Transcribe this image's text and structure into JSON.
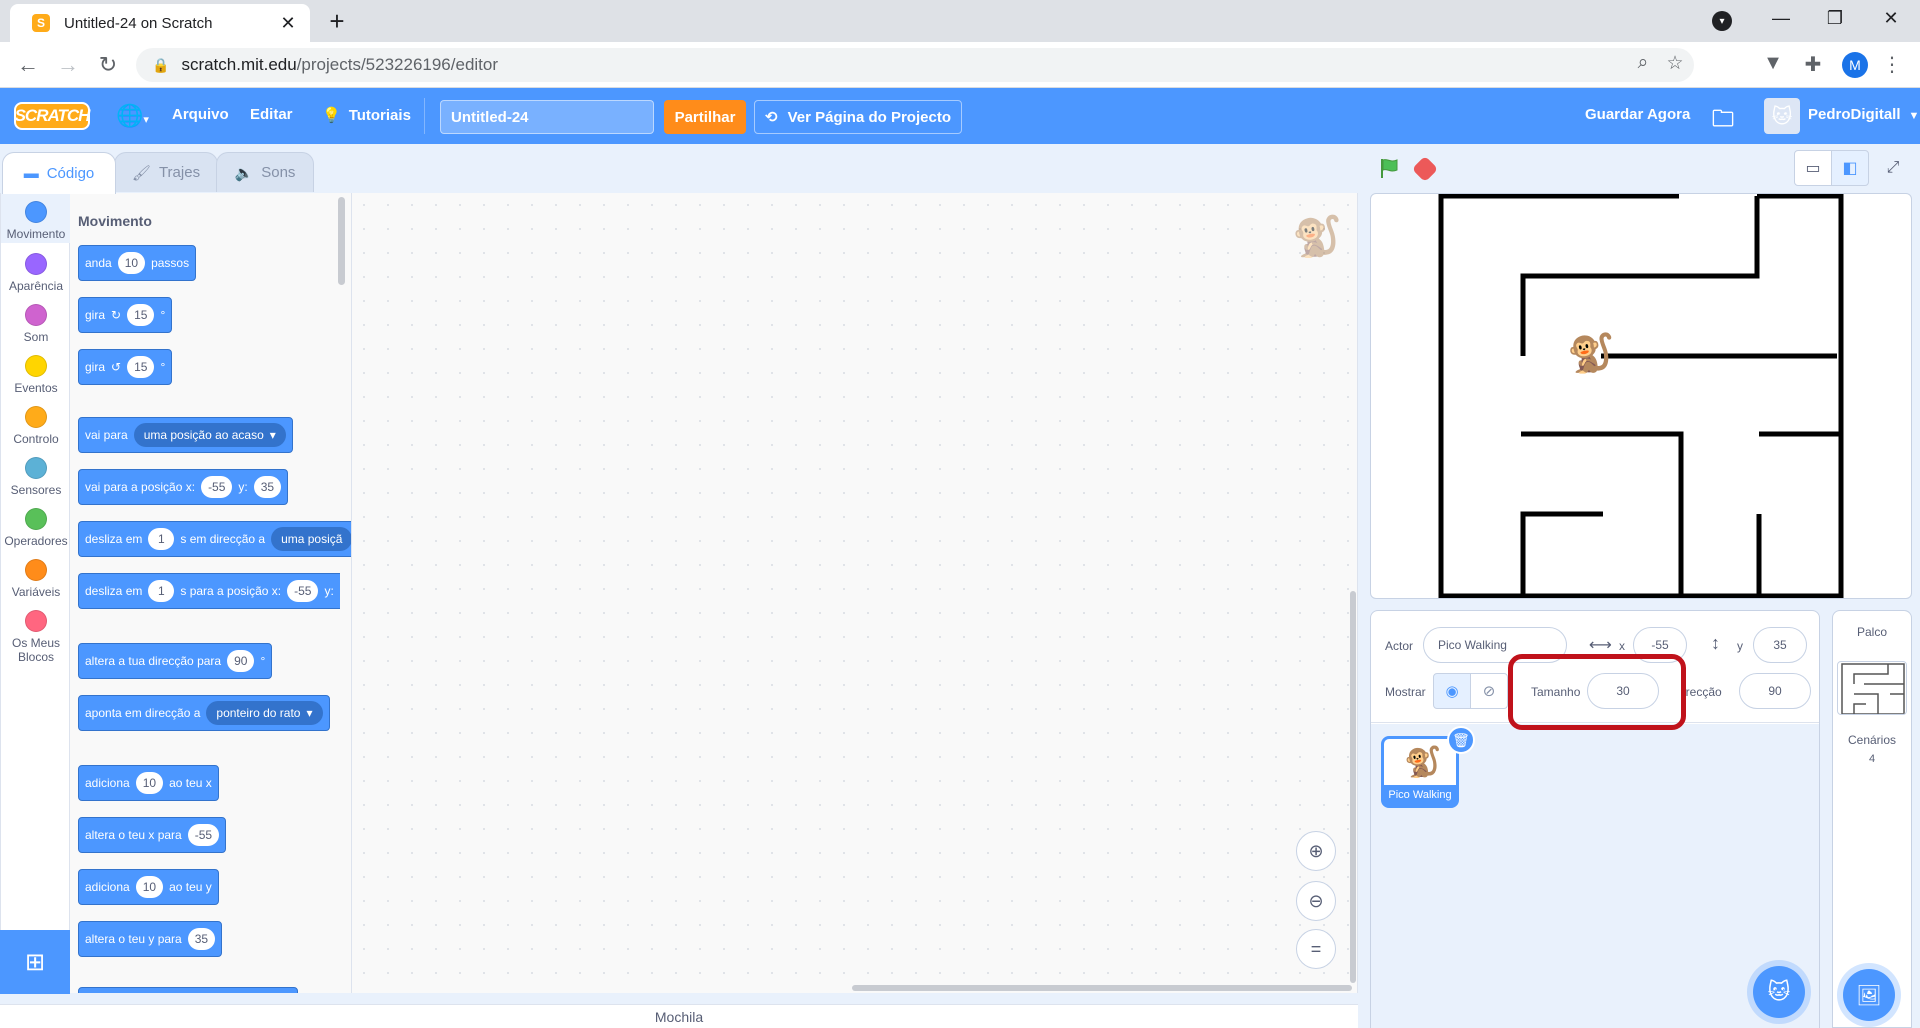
{
  "browser": {
    "tab_title": "Untitled-24 on Scratch",
    "url_host": "scratch.mit.edu",
    "url_path": "/projects/523226196/editor",
    "profile_initial": "M"
  },
  "menubar": {
    "logo": "SCRATCH",
    "file": "Arquivo",
    "edit": "Editar",
    "tutorials": "Tutoriais",
    "project_title": "Untitled-24",
    "share": "Partilhar",
    "see_project": "Ver Página do Projecto",
    "save_now": "Guardar Agora",
    "username": "PedroDigitall"
  },
  "editor_tabs": {
    "code": "Código",
    "costumes": "Trajes",
    "sounds": "Sons"
  },
  "categories": [
    {
      "label": "Movimento",
      "color": "#4c97ff"
    },
    {
      "label": "Aparência",
      "color": "#9966ff"
    },
    {
      "label": "Som",
      "color": "#cf63cf"
    },
    {
      "label": "Eventos",
      "color": "#ffd500"
    },
    {
      "label": "Controlo",
      "color": "#ffab19"
    },
    {
      "label": "Sensores",
      "color": "#5cb1d6"
    },
    {
      "label": "Operadores",
      "color": "#59c059"
    },
    {
      "label": "Variáveis",
      "color": "#ff8c1a"
    },
    {
      "label": "Os Meus Blocos",
      "color": "#ff6680"
    }
  ],
  "palette": {
    "heading": "Movimento",
    "b1": {
      "a": "anda",
      "v": "10",
      "b": "passos"
    },
    "b2": {
      "a": "gira",
      "v": "15",
      "deg": "°"
    },
    "b3": {
      "a": "gira",
      "v": "15",
      "deg": "°"
    },
    "b4": {
      "a": "vai para",
      "dd": "uma posição ao acaso"
    },
    "b5": {
      "a": "vai para a posição x:",
      "x": "-55",
      "b": "y:",
      "y": "35"
    },
    "b6": {
      "a": "desliza em",
      "v": "1",
      "b": "s em direcção a",
      "dd": "uma posiçã"
    },
    "b7": {
      "a": "desliza em",
      "v": "1",
      "b": "s para a posição x:",
      "x": "-55",
      "c": "y:"
    },
    "b8": {
      "a": "altera a tua direcção para",
      "v": "90",
      "deg": "°"
    },
    "b9": {
      "a": "aponta em direcção a",
      "dd": "ponteiro do rato"
    },
    "b10": {
      "a": "adiciona",
      "v": "10",
      "b": "ao teu x"
    },
    "b11": {
      "a": "altera o teu x para",
      "v": "-55"
    },
    "b12": {
      "a": "adiciona",
      "v": "10",
      "b": "ao teu y"
    },
    "b13": {
      "a": "altera o teu y para",
      "v": "35"
    }
  },
  "backpack": "Mochila",
  "sprite_info": {
    "sprite_label": "Actor",
    "sprite_name": "Pico Walking",
    "x_label": "x",
    "x": "-55",
    "y_label": "y",
    "y": "35",
    "show_label": "Mostrar",
    "size_label": "Tamanho",
    "size": "30",
    "direction_label": "irecção",
    "direction": "90"
  },
  "sprites": [
    {
      "name": "Pico Walking"
    }
  ],
  "stage_panel": {
    "title": "Palco",
    "backdrops_label": "Cenários",
    "backdrops_count": "4"
  }
}
